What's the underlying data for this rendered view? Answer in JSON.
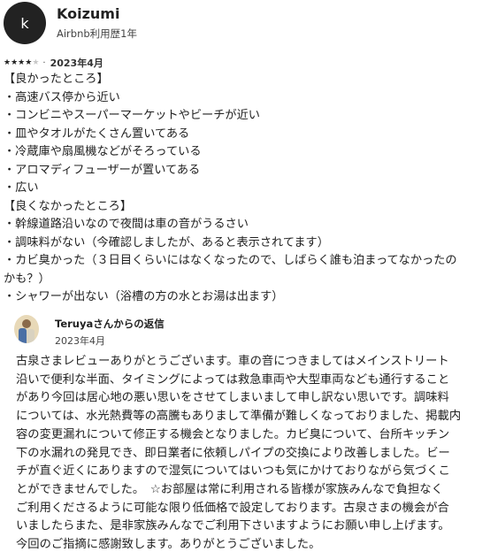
{
  "reviewer": {
    "avatar_initial": "k",
    "name": "Koizumi",
    "meta": "Airbnb利用歴1年"
  },
  "rating": {
    "stars_filled": 4,
    "stars_total": 5,
    "separator": "·",
    "date": "2023年4月"
  },
  "review": {
    "lines": [
      "【良かったところ】",
      "・高速バス停から近い",
      "・コンビニやスーパーマーケットやビーチが近い",
      "・皿やタオルがたくさん置いてある",
      "・冷蔵庫や扇風機などがそろっている",
      "・アロマディフューザーが置いてある",
      "・広い",
      "【良くなかったところ】",
      "・幹線道路沿いなので夜間は車の音がうるさい",
      "・調味料がない（今確認しましたが、あると表示されてます）",
      "・カビ臭かった（３日目くらいにはなくなったので、しばらく誰も泊まってなかったの",
      "かも？）",
      "・シャワーが出ない（浴槽の方の水とお湯は出ます）"
    ]
  },
  "reply": {
    "title": "Teruyaさんからの返信",
    "date": "2023年4月",
    "lines": [
      "古泉さまレビューありがとうございます。車の音につきましてはメインストリート",
      "沿いで便利な半面、タイミングによっては救急車両や大型車両なども通行すること",
      "があり今回は居心地の悪い思いをさせてしまいまして申し訳ない思いです。調味料",
      "については、水光熱費等の高騰もありまして準備が難しくなっておりました、掲載内",
      "容の変更漏れについて修正する機会となりました。カビ臭について、台所キッチン",
      "下の水漏れの発見でき、即日業者に依頼しパイプの交換により改善しました。ビー",
      "チが直ぐ近くにありますので湿気についてはいつも気にかけておりながら気づくこ",
      "とができませんでした。　☆お部屋は常に利用される皆様が家族みんなで負担なく",
      "ご利用くださるように可能な限り低価格で設定しております。古泉さまの機会が合",
      "いましたらまた、是非家族みんなでご利用下さいますようにお願い申し上げます。",
      "今回のご指摘に感謝致します。ありがとうございました。"
    ]
  }
}
